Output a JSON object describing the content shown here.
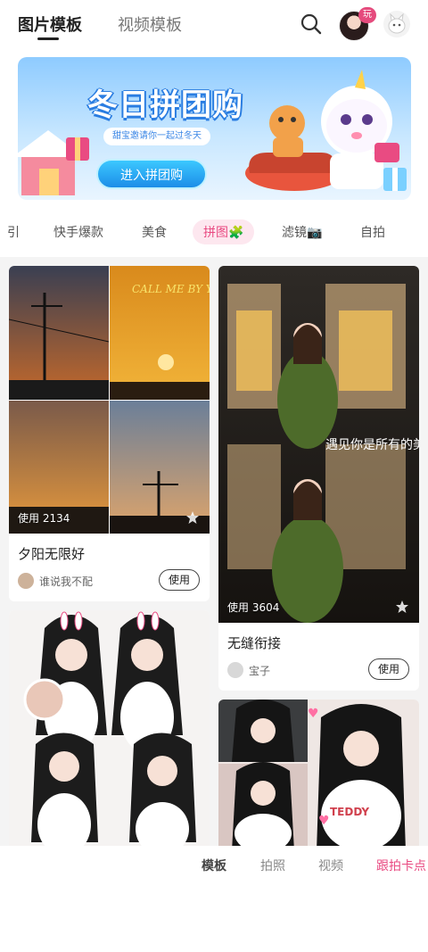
{
  "header": {
    "tabs": [
      {
        "label": "图片模板",
        "active": true
      },
      {
        "label": "视频模板",
        "active": false
      }
    ],
    "avatar_badge": "玩",
    "icons": [
      "search-icon",
      "avatar",
      "pet-icon"
    ]
  },
  "banner": {
    "title": "冬日拼团购",
    "subtitle": "甜宝邀请你一起过冬天",
    "cta": "进入拼团购"
  },
  "categories": [
    {
      "label": "引",
      "active": false
    },
    {
      "label": "快手爆款",
      "active": false
    },
    {
      "label": "美食",
      "active": false
    },
    {
      "label": "拼图🧩",
      "active": true
    },
    {
      "label": "滤镜📷",
      "active": false
    },
    {
      "label": "自拍",
      "active": false
    }
  ],
  "cards": [
    {
      "usage": "使用 2134",
      "title": "夕阳无限好",
      "author": "谁说我不配",
      "button": "使用",
      "overlay": "CALL ME BY YOUR NAME"
    },
    {
      "usage": "使用 3604",
      "title": "无缝衔接",
      "author": "宝子",
      "button": "使用",
      "overlay": "遇见你是所有的美好"
    },
    {
      "usage": "",
      "title": "",
      "author": "",
      "button": ""
    },
    {
      "usage": "",
      "title": "",
      "author": "",
      "button": ""
    }
  ],
  "bottom_tabs": [
    {
      "label": "模板",
      "active": true
    },
    {
      "label": "拍照",
      "active": false
    },
    {
      "label": "视频",
      "active": false
    },
    {
      "label": "跟拍卡点",
      "active": false,
      "highlight": true
    }
  ],
  "colors": {
    "accent": "#e94b82",
    "banner_blue": "#2a7de1",
    "feed_bg": "#f4f4f4"
  }
}
